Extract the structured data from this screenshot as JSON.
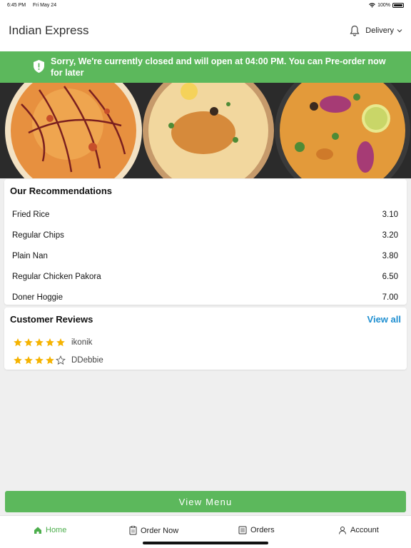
{
  "status": {
    "time": "6:45 PM",
    "date": "Fri May 24",
    "battery": "100%"
  },
  "header": {
    "title": "Indian Express",
    "mode": "Delivery"
  },
  "banner": {
    "message": "Sorry, We're currently closed and will open at 04:00 PM. You can Pre-order now for later",
    "color": "#5cb85c"
  },
  "recommendations": {
    "title": "Our Recommendations",
    "items": [
      {
        "name": "Fried Rice",
        "price": "3.10"
      },
      {
        "name": "Regular Chips",
        "price": "3.20"
      },
      {
        "name": "Plain Nan",
        "price": "3.80"
      },
      {
        "name": "Regular Chicken Pakora",
        "price": "6.50"
      },
      {
        "name": "Doner Hoggie",
        "price": "7.00"
      }
    ]
  },
  "reviews": {
    "title": "Customer Reviews",
    "view_all": "View all",
    "items": [
      {
        "user": "ikonik",
        "rating": 5
      },
      {
        "user": "DDebbie",
        "rating": 4
      }
    ]
  },
  "view_menu": "View Menu",
  "tabs": [
    {
      "label": "Home",
      "icon": "home-icon",
      "active": true
    },
    {
      "label": "Order Now",
      "icon": "order-icon",
      "active": false
    },
    {
      "label": "Orders",
      "icon": "orders-icon",
      "active": false
    },
    {
      "label": "Account",
      "icon": "account-icon",
      "active": false
    }
  ],
  "colors": {
    "accent": "#5cb85c",
    "link": "#1f8fd1",
    "star": "#f5b301"
  }
}
